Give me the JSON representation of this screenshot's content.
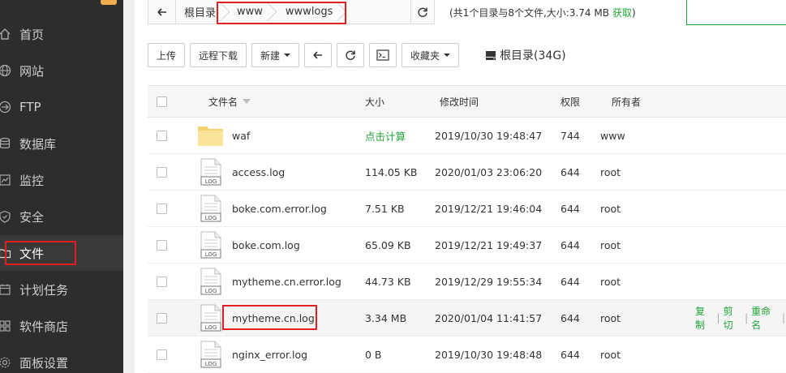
{
  "sidebar": {
    "items": [
      {
        "label": "首页",
        "icon": "home-icon"
      },
      {
        "label": "网站",
        "icon": "globe-icon"
      },
      {
        "label": "FTP",
        "icon": "ftp-icon"
      },
      {
        "label": "数据库",
        "icon": "database-icon"
      },
      {
        "label": "监控",
        "icon": "monitor-icon"
      },
      {
        "label": "安全",
        "icon": "shield-icon"
      },
      {
        "label": "文件",
        "icon": "folder-icon",
        "active": true
      },
      {
        "label": "计划任务",
        "icon": "calendar-icon"
      },
      {
        "label": "软件商店",
        "icon": "apps-icon"
      },
      {
        "label": "面板设置",
        "icon": "gear-icon"
      }
    ]
  },
  "path": {
    "crumbs": [
      "根目录",
      "www",
      "wwwlogs"
    ]
  },
  "summary": {
    "text": "(共1个目录与8个文件,大小:3.74 MB",
    "get_label": "获取",
    "close": ")"
  },
  "toolbar": {
    "upload": "上传",
    "remote_download": "远程下载",
    "new": "新建",
    "favorites": "收藏夹",
    "disk_label": "根目录(34G)"
  },
  "table": {
    "headers": {
      "name": "文件名",
      "size": "大小",
      "mtime": "修改时间",
      "perm": "权限",
      "owner": "所有者"
    },
    "rows": [
      {
        "type": "folder",
        "name": "waf",
        "size": "点击计算",
        "mtime": "2019/10/30 19:48:47",
        "perm": "744",
        "owner": "www"
      },
      {
        "type": "log",
        "name": "access.log",
        "size": "114.05 KB",
        "mtime": "2020/01/03 23:06:20",
        "perm": "644",
        "owner": "root"
      },
      {
        "type": "log",
        "name": "boke.com.error.log",
        "size": "7.51 KB",
        "mtime": "2019/12/21 19:46:04",
        "perm": "644",
        "owner": "root"
      },
      {
        "type": "log",
        "name": "boke.com.log",
        "size": "65.09 KB",
        "mtime": "2019/12/21 19:49:37",
        "perm": "644",
        "owner": "root"
      },
      {
        "type": "log",
        "name": "mytheme.cn.error.log",
        "size": "44.73 KB",
        "mtime": "2019/12/29 19:55:34",
        "perm": "644",
        "owner": "root"
      },
      {
        "type": "log",
        "name": "mytheme.cn.log",
        "size": "3.34 MB",
        "mtime": "2020/01/04 11:41:57",
        "perm": "644",
        "owner": "root"
      },
      {
        "type": "log",
        "name": "nginx_error.log",
        "size": "0 B",
        "mtime": "2019/10/30 19:48:48",
        "perm": "644",
        "owner": "root"
      }
    ],
    "row_ops": [
      "复制",
      "剪切",
      "重命名"
    ],
    "file_icon_text": "LOG"
  },
  "colors": {
    "accent": "#20a53a",
    "highlight": "#e02020",
    "sidebar_bg": "#2d2d2d"
  }
}
